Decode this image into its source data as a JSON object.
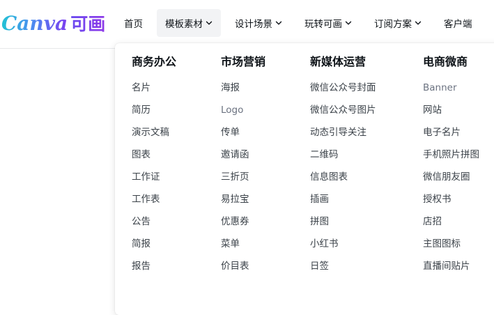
{
  "logo": {
    "text": "Canva",
    "cn": "可画"
  },
  "nav": {
    "items": [
      {
        "label": "首页"
      },
      {
        "label": "模板素材"
      },
      {
        "label": "设计场景"
      },
      {
        "label": "玩转可画"
      },
      {
        "label": "订阅方案"
      },
      {
        "label": "客户端"
      }
    ],
    "active": "模板素材"
  },
  "dropdown": {
    "columns": [
      {
        "title": "商务办公",
        "items": [
          "名片",
          "简历",
          "演示文稿",
          "图表",
          "工作证",
          "工作表",
          "公告",
          "简报",
          "报告"
        ]
      },
      {
        "title": "市场营销",
        "items": [
          "海报",
          "Logo",
          "传单",
          "邀请函",
          "三折页",
          "易拉宝",
          "优惠券",
          "菜单",
          "价目表"
        ]
      },
      {
        "title": "新媒体运营",
        "items": [
          "微信公众号封面",
          "微信公众号图片",
          "动态引导关注",
          "二维码",
          "信息图表",
          "插画",
          "拼图",
          "小红书",
          "日签"
        ]
      },
      {
        "title": "电商微商",
        "items": [
          "Banner",
          "网站",
          "电子名片",
          "手机照片拼图",
          "微信朋友圈",
          "授权书",
          "店招",
          "主图图标",
          "直播间贴片"
        ]
      }
    ]
  },
  "colors": {
    "text": "#0e1318",
    "item_text": "#3b4249",
    "active_bg": "#f2f3f5",
    "brand_gradient_start": "#22c3d4",
    "brand_gradient_end": "#7d3cf0"
  }
}
